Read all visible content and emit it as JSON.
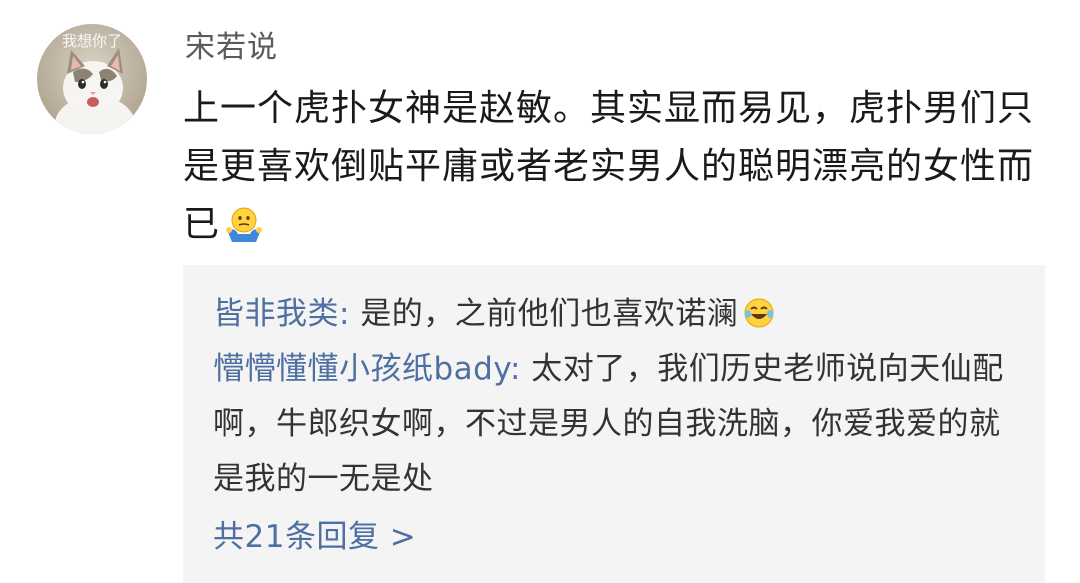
{
  "post": {
    "author": "宋若说",
    "avatar_watermark": "我想你了",
    "comment_text": "上一个虎扑女神是赵敏。其实显而易见，虎扑男们只是更喜欢倒贴平庸或者老实男人的聪明漂亮的女性而已",
    "comment_emoji": "shrug-emoji"
  },
  "replies": [
    {
      "name": "皆非我类",
      "separator": ": ",
      "text": "是的，之前他们也喜欢诺澜",
      "emoji": "laugh-cry-emoji"
    },
    {
      "name": "懵懵懂懂小孩纸bady",
      "separator": ": ",
      "text": "太对了，我们历史老师说向天仙配啊，牛郎织女啊，不过是男人的自我洗脑，你爱我爱的就是我的一无是处"
    }
  ],
  "more_replies_label": "共21条回复 >",
  "colors": {
    "link": "#4e6fa1",
    "reply_bg": "#f4f4f4",
    "author": "#5b5b5b"
  }
}
